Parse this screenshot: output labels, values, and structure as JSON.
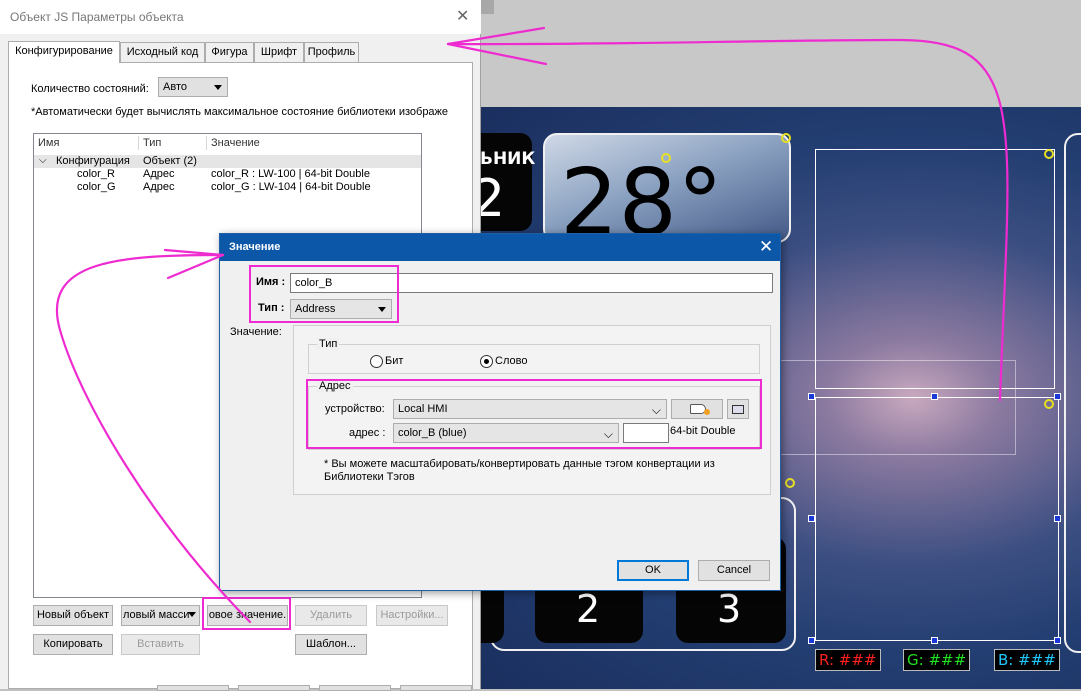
{
  "colors": {
    "accent": "#0d57a8",
    "highlight": "#ee2bd0",
    "canvas_dark": "#1a2f5e"
  },
  "main_dialog": {
    "title": "Объект JS Параметры объекта",
    "tabs": [
      {
        "label": "Конфигурирование"
      },
      {
        "label": "Исходный код"
      },
      {
        "label": "Фигура"
      },
      {
        "label": "Шрифт"
      },
      {
        "label": "Профиль"
      }
    ],
    "states_label": "Количество состояний:",
    "states_value": "Авто",
    "auto_note": "*Автоматически будет вычислять максимальное состояние библиотеки изображе",
    "tree": {
      "headers": {
        "name": "Имя",
        "type": "Тип",
        "value": "Значение"
      },
      "rows": [
        {
          "name": "Конфигурация",
          "type": "Объект (2)",
          "value": ""
        },
        {
          "name": "color_R",
          "type": "Адрес",
          "value": "color_R : LW-100 | 64-bit Double"
        },
        {
          "name": "color_G",
          "type": "Адрес",
          "value": "color_G : LW-104 | 64-bit Double"
        }
      ]
    },
    "buttons": {
      "new_object": "Новый объект",
      "new_array": "ловый масси",
      "new_value": "овое значение.",
      "delete": "Удалить",
      "settings": "Настройки...",
      "copy": "Копировать",
      "paste": "Вставить",
      "template": "Шаблон..."
    }
  },
  "value_dialog": {
    "title": "Значение",
    "name_label": "Имя :",
    "name_value": "color_B",
    "type_label": "Тип :",
    "type_value": "Address",
    "value_label": "Значение:",
    "type_group_title": "Тип",
    "radio_bit": "Бит",
    "radio_word": "Слово",
    "address_group_title": "Адрес",
    "device_label": "устройство:",
    "device_value": "Local HMI",
    "address_label": "адрес :",
    "address_value": "color_B (blue)",
    "format_text": "64-bit Double",
    "note": "* Вы можете масштабировать/конвертировать данные тэгом конвертации из Библиотеки Тэгов",
    "ok": "OK",
    "cancel": "Cancel"
  },
  "canvas": {
    "partial_label": "ьник",
    "partial_digit": "2",
    "temperature": "28°",
    "key_2": "2",
    "key_3": "3",
    "rgb": {
      "r": "R: ###",
      "r_color": "#ff2020",
      "g": "G: ###",
      "g_color": "#20e020",
      "b": "B: ###",
      "b_color": "#20c8ff"
    }
  }
}
